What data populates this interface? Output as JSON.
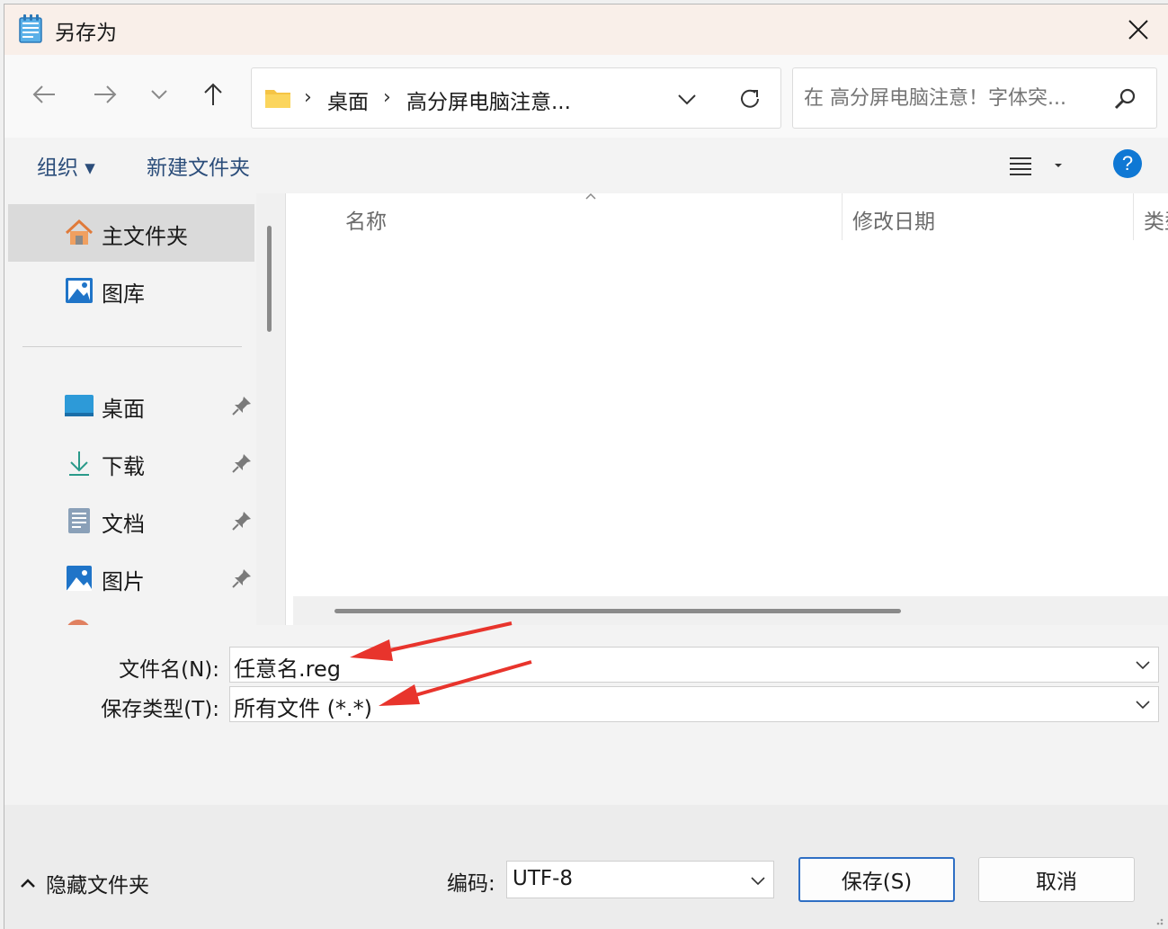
{
  "window": {
    "title": "另存为",
    "app_icon": "notepad-icon",
    "close_icon": "close-icon"
  },
  "nav": {
    "back_icon": "arrow-left-icon",
    "forward_icon": "arrow-right-icon",
    "recent_icon": "chevron-down-icon",
    "up_icon": "arrow-up-icon",
    "breadcrumb": [
      "桌面",
      "高分屏电脑注意..."
    ],
    "refresh_icon": "refresh-icon",
    "search_placeholder": "在 高分屏电脑注意！字体突..."
  },
  "toolbar": {
    "organize": "组织 ▾",
    "new_folder": "新建文件夹",
    "help": "?"
  },
  "sidebar": {
    "items": [
      {
        "label": "主文件夹",
        "icon": "home-icon",
        "pinned": false,
        "selected": true
      },
      {
        "label": "图库",
        "icon": "gallery-icon",
        "pinned": false,
        "selected": false
      },
      {
        "label": "桌面",
        "icon": "desktop-icon",
        "pinned": true,
        "selected": false
      },
      {
        "label": "下载",
        "icon": "download-icon",
        "pinned": true,
        "selected": false
      },
      {
        "label": "文档",
        "icon": "document-icon",
        "pinned": true,
        "selected": false
      },
      {
        "label": "图片",
        "icon": "pictures-icon",
        "pinned": true,
        "selected": false
      }
    ]
  },
  "file_list": {
    "columns": [
      "名称",
      "修改日期",
      "类型"
    ]
  },
  "form": {
    "filename_label": "文件名(N):",
    "filename_value": "任意名.reg",
    "filetype_label": "保存类型(T):",
    "filetype_value": "所有文件 (*.*)"
  },
  "footer": {
    "hide_folders": "隐藏文件夹",
    "encoding_label": "编码:",
    "encoding_value": "UTF-8",
    "save_button": "保存(S)",
    "cancel_button": "取消"
  },
  "colors": {
    "title_bg": "#f9efe9",
    "accent": "#0f78d4",
    "annotation_arrow": "#e8342c"
  }
}
